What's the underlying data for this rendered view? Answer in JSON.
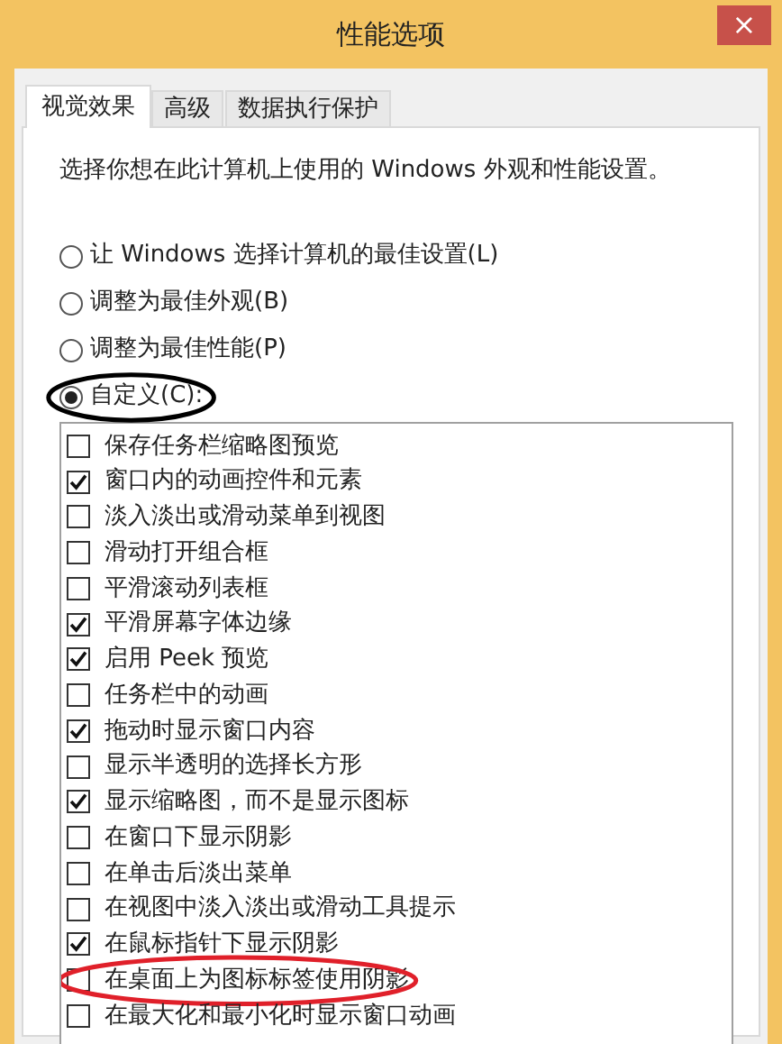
{
  "window": {
    "title": "性能选项",
    "close": "×"
  },
  "tabs": [
    {
      "label": "视觉效果",
      "selected": true
    },
    {
      "label": "高级",
      "selected": false
    },
    {
      "label": "数据执行保护",
      "selected": false
    }
  ],
  "description": "选择你想在此计算机上使用的 Windows 外观和性能设置。",
  "radios": [
    {
      "label": "让 Windows 选择计算机的最佳设置(L)",
      "selected": false
    },
    {
      "label": "调整为最佳外观(B)",
      "selected": false
    },
    {
      "label": "调整为最佳性能(P)",
      "selected": false
    },
    {
      "label": "自定义(C):",
      "selected": true,
      "color": "#000000"
    }
  ],
  "options": [
    {
      "label": "保存任务栏缩略图预览",
      "checked": false
    },
    {
      "label": "窗口内的动画控件和元素",
      "checked": true
    },
    {
      "label": "淡入淡出或滑动菜单到视图",
      "checked": false
    },
    {
      "label": "滑动打开组合框",
      "checked": false
    },
    {
      "label": "平滑滚动列表框",
      "checked": false
    },
    {
      "label": "平滑屏幕字体边缘",
      "checked": true
    },
    {
      "label": "启用 Peek 预览",
      "checked": true
    },
    {
      "label": "任务栏中的动画",
      "checked": false
    },
    {
      "label": "拖动时显示窗口内容",
      "checked": true
    },
    {
      "label": "显示半透明的选择长方形",
      "checked": false
    },
    {
      "label": "显示缩略图，而不是显示图标",
      "checked": true
    },
    {
      "label": "在窗口下显示阴影",
      "checked": false
    },
    {
      "label": "在单击后淡出菜单",
      "checked": false
    },
    {
      "label": "在视图中淡入淡出或滑动工具提示",
      "checked": false
    },
    {
      "label": "在鼠标指针下显示阴影",
      "checked": true
    },
    {
      "label": "在桌面上为图标标签使用阴影",
      "checked": false,
      "color": "#e0202a"
    },
    {
      "label": "在最大化和最小化时显示窗口动画",
      "checked": false
    }
  ]
}
